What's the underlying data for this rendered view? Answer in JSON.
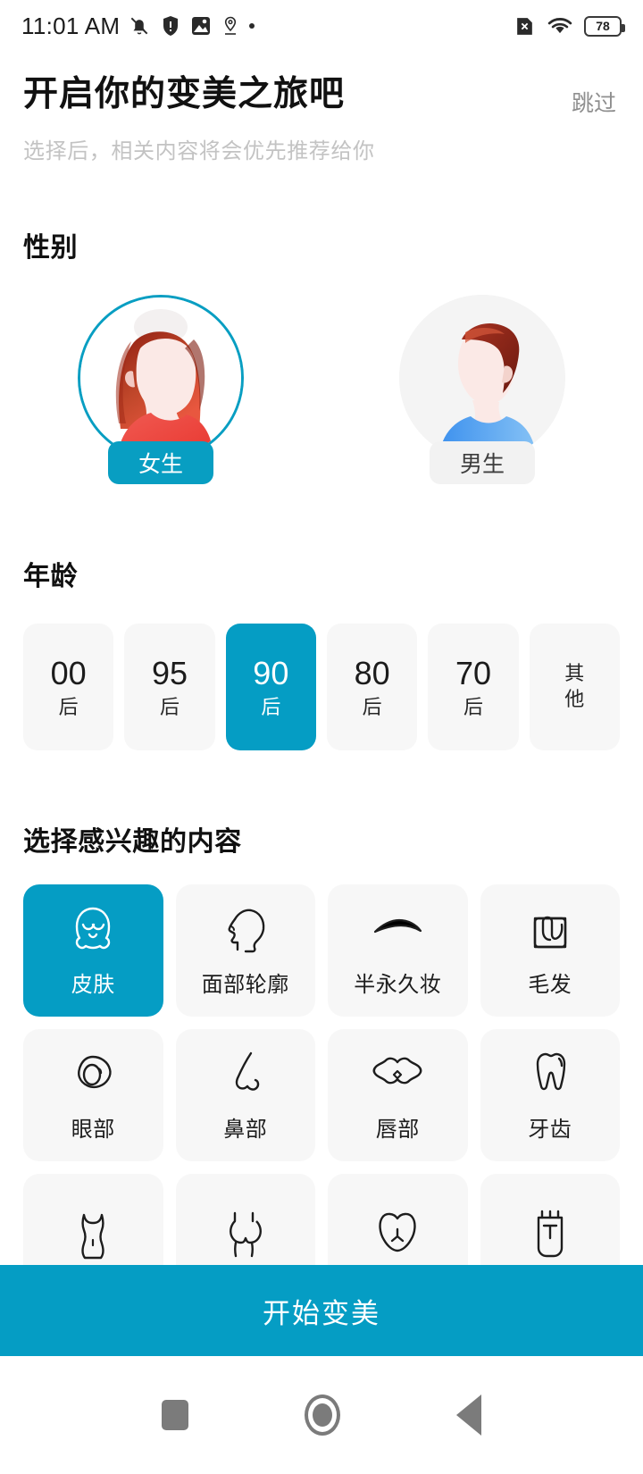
{
  "statusbar": {
    "time": "11:01 AM",
    "battery_level": "78",
    "left_icons": [
      "bell-muted-icon",
      "shield-icon",
      "image-sync-icon",
      "location-pin-icon",
      "more-dot-icon"
    ],
    "right_icons": [
      "sim-disabled-icon",
      "wifi-icon",
      "battery-icon"
    ]
  },
  "header": {
    "title": "开启你的变美之旅吧",
    "subtitle": "选择后，相关内容将会优先推荐给你",
    "skip_label": "跳过"
  },
  "gender": {
    "section_title": "性别",
    "options": [
      {
        "label": "女生",
        "selected": true
      },
      {
        "label": "男生",
        "selected": false
      }
    ]
  },
  "age": {
    "section_title": "年龄",
    "options": [
      {
        "line1": "00",
        "line2": "后",
        "selected": false
      },
      {
        "line1": "95",
        "line2": "后",
        "selected": false
      },
      {
        "line1": "90",
        "line2": "后",
        "selected": true
      },
      {
        "line1": "80",
        "line2": "后",
        "selected": false
      },
      {
        "line1": "70",
        "line2": "后",
        "selected": false
      },
      {
        "line1": "其",
        "line2": "他",
        "selected": false
      }
    ]
  },
  "interests": {
    "section_title": "选择感兴趣的内容",
    "items": [
      {
        "label": "皮肤",
        "icon": "face-skin-icon",
        "selected": true
      },
      {
        "label": "面部轮廓",
        "icon": "head-profile-icon",
        "selected": false
      },
      {
        "label": "半永久妆",
        "icon": "eyebrow-icon",
        "selected": false
      },
      {
        "label": "毛发",
        "icon": "hair-follicle-icon",
        "selected": false
      },
      {
        "label": "眼部",
        "icon": "eye-icon",
        "selected": false
      },
      {
        "label": "鼻部",
        "icon": "nose-icon",
        "selected": false
      },
      {
        "label": "唇部",
        "icon": "lips-icon",
        "selected": false
      },
      {
        "label": "牙齿",
        "icon": "tooth-icon",
        "selected": false
      },
      {
        "label": "",
        "icon": "torso-icon",
        "selected": false
      },
      {
        "label": "",
        "icon": "chest-icon",
        "selected": false
      },
      {
        "label": "",
        "icon": "hip-icon",
        "selected": false
      },
      {
        "label": "",
        "icon": "device-icon",
        "selected": false
      }
    ]
  },
  "cta": {
    "label": "开始变美"
  },
  "navbar": {
    "items": [
      "recents-square-icon",
      "home-circle-icon",
      "back-triangle-icon"
    ]
  },
  "colors": {
    "accent": "#059dc4",
    "accent_ring": "#089ec2",
    "tile_bg": "#f7f7f7",
    "muted_text": "#c3c3c3"
  }
}
